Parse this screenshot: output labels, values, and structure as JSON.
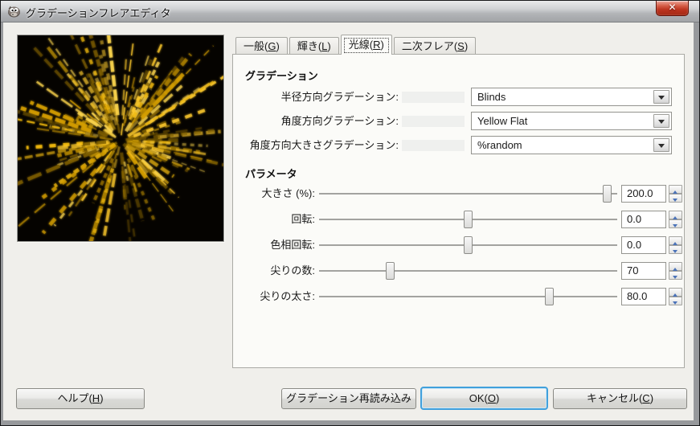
{
  "window": {
    "title": "グラデーションフレアエディタ",
    "close_glyph": "✕"
  },
  "tabs": [
    {
      "pre": "一般(",
      "key": "G",
      "post": ")",
      "selected": false
    },
    {
      "pre": "輝き(",
      "key": "L",
      "post": ")",
      "selected": false
    },
    {
      "pre": "光線(",
      "key": "R",
      "post": ")",
      "selected": true
    },
    {
      "pre": "二次フレア(",
      "key": "S",
      "post": ")",
      "selected": false
    }
  ],
  "gradients_section": {
    "title": "グラデーション",
    "rows": [
      {
        "label": "半径方向グラデーション:",
        "value": "Blinds"
      },
      {
        "label": "角度方向グラデーション:",
        "value": "Yellow Flat"
      },
      {
        "label": "角度方向大きさグラデーション:",
        "value": "%random"
      }
    ]
  },
  "parameters_section": {
    "title": "パラメータ",
    "rows": [
      {
        "label": "大きさ (%):",
        "value": "200.0",
        "percent": 98
      },
      {
        "label": "回転:",
        "value": "0.0",
        "percent": 50
      },
      {
        "label": "色相回転:",
        "value": "0.0",
        "percent": 50
      },
      {
        "label": "尖りの数:",
        "value": "70",
        "percent": 23
      },
      {
        "label": "尖りの太さ:",
        "value": "80.0",
        "percent": 78
      }
    ]
  },
  "footer": {
    "help": {
      "pre": "ヘルプ(",
      "key": "H",
      "post": ")"
    },
    "reload": {
      "label": "グラデーション再読み込み"
    },
    "ok": {
      "pre": "OK(",
      "key": "O",
      "post": ")"
    },
    "cancel": {
      "pre": "キャンセル(",
      "key": "C",
      "post": ")"
    }
  },
  "preview": {
    "spikes": 70,
    "background": "#050300",
    "flare_colors": [
      "#ffd84f",
      "#f3bb0e",
      "#d7a000",
      "#ab8000",
      "#7c5d00",
      "#ffcb2d"
    ]
  },
  "colors": {
    "ok_focus_blue": "#41a0dc",
    "close_red": "#bd3520",
    "titlebar_gray": "#b3b5b8",
    "dialog_bg": "#f0efeb",
    "panel_bg": "#fbfbf8",
    "spin_arrow_blue": "#4a72b8"
  }
}
